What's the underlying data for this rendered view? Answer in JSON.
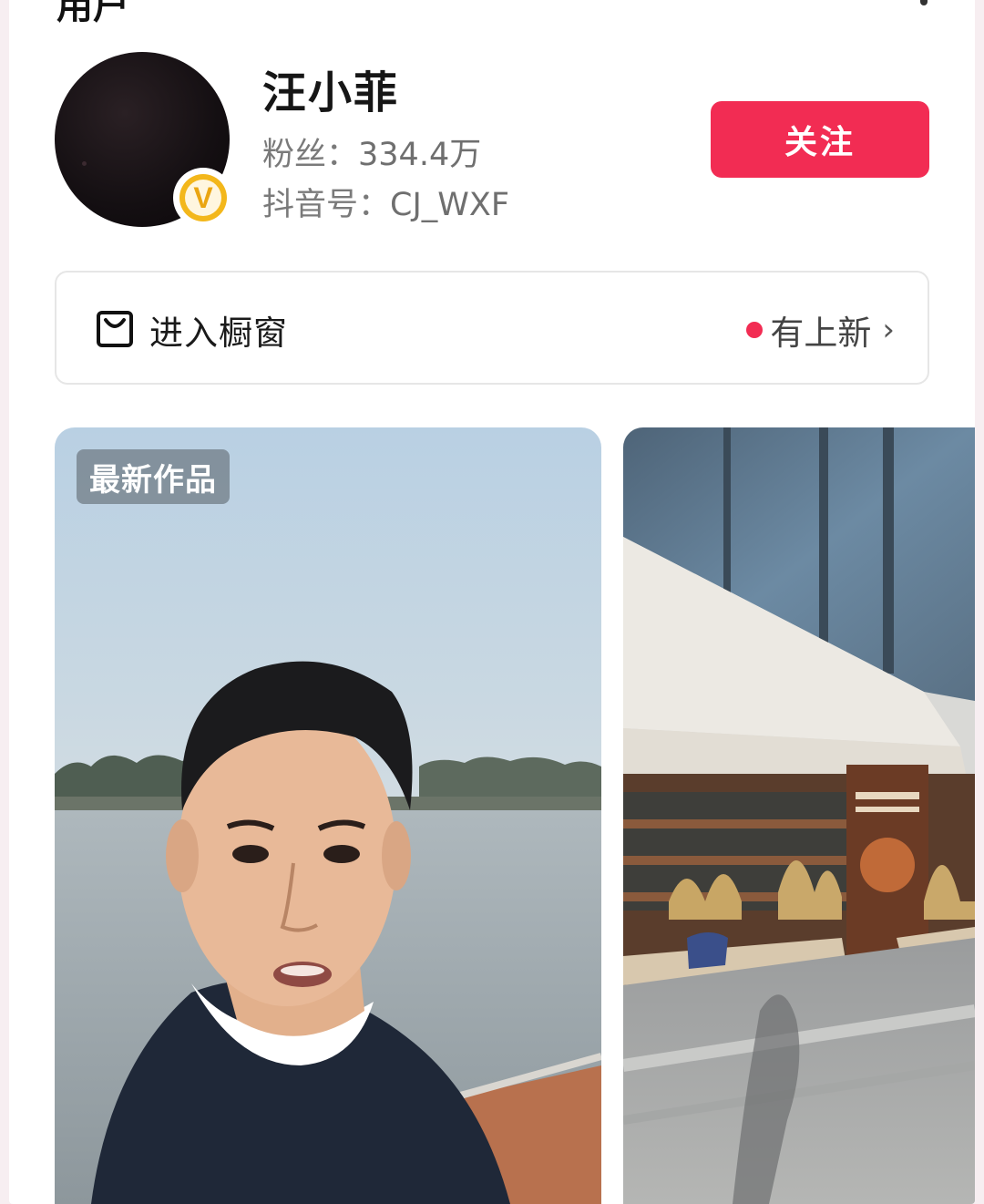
{
  "header": {
    "partial_title": "用户"
  },
  "profile": {
    "name": "汪小菲",
    "fans_label": "粉丝：",
    "fans_value": "334.4万",
    "id_label": "抖音号：",
    "id_value": "CJ_WXF",
    "verified_badge": "V",
    "follow_label": "关注"
  },
  "shop": {
    "icon": "shopping-bag-icon",
    "label": "进入橱窗",
    "new_label": "有上新",
    "chevron": "›"
  },
  "videos": [
    {
      "badge": "最新作品"
    },
    {
      "badge": ""
    }
  ],
  "colors": {
    "accent": "#f22c53",
    "verified": "#f3b71b"
  }
}
